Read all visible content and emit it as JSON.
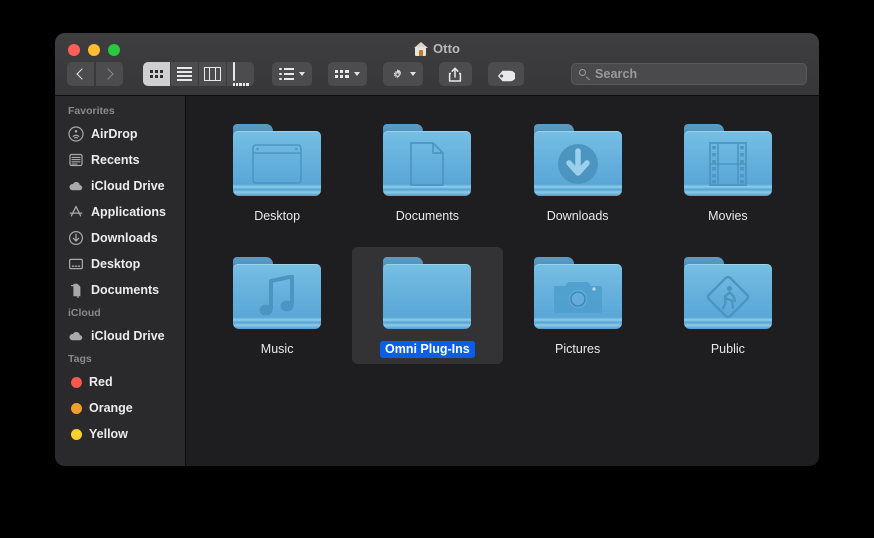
{
  "window": {
    "title": "Otto",
    "title_icon": "home-icon"
  },
  "traffic_lights": [
    {
      "name": "close-button",
      "color": "#ff5f57"
    },
    {
      "name": "minimize-button",
      "color": "#febc2e"
    },
    {
      "name": "maximize-button",
      "color": "#28c840"
    }
  ],
  "toolbar": {
    "back_icon": "chevron-left-icon",
    "forward_icon": "chevron-right-icon",
    "view_modes": [
      {
        "label": "Icon view",
        "icon": "grid-icon",
        "active": true
      },
      {
        "label": "List view",
        "icon": "list-icon",
        "active": false
      },
      {
        "label": "Column view",
        "icon": "columns-icon",
        "active": false
      },
      {
        "label": "Gallery view",
        "icon": "gallery-icon",
        "active": false
      }
    ],
    "arrange_icon": "arrange-icon",
    "group_icon": "group-icon",
    "action_icon": "gear-icon",
    "share_icon": "share-icon",
    "tag_icon": "tag-icon"
  },
  "search": {
    "placeholder": "Search",
    "value": "",
    "icon": "search-icon"
  },
  "sidebar": {
    "sections": [
      {
        "header": "Favorites",
        "items": [
          {
            "label": "AirDrop",
            "icon": "airdrop-icon"
          },
          {
            "label": "Recents",
            "icon": "recents-icon"
          },
          {
            "label": "iCloud Drive",
            "icon": "cloud-icon"
          },
          {
            "label": "Applications",
            "icon": "applications-icon"
          },
          {
            "label": "Downloads",
            "icon": "downloads-icon"
          },
          {
            "label": "Desktop",
            "icon": "desktop-icon"
          },
          {
            "label": "Documents",
            "icon": "documents-icon"
          }
        ]
      },
      {
        "header": "iCloud",
        "items": [
          {
            "label": "iCloud Drive",
            "icon": "cloud-icon"
          }
        ]
      },
      {
        "header": "Tags",
        "items": [
          {
            "label": "Red",
            "icon": "tag-dot",
            "color": "#f7584c"
          },
          {
            "label": "Orange",
            "icon": "tag-dot",
            "color": "#f0a02a"
          },
          {
            "label": "Yellow",
            "icon": "tag-dot",
            "color": "#f7d02c"
          }
        ]
      }
    ]
  },
  "content": {
    "items": [
      {
        "label": "Desktop",
        "glyph": "window-glyph",
        "selected": false
      },
      {
        "label": "Documents",
        "glyph": "document-glyph",
        "selected": false
      },
      {
        "label": "Downloads",
        "glyph": "download-glyph",
        "selected": false
      },
      {
        "label": "Movies",
        "glyph": "film-glyph",
        "selected": false
      },
      {
        "label": "Music",
        "glyph": "music-glyph",
        "selected": false
      },
      {
        "label": "Omni Plug-Ins",
        "glyph": "none",
        "selected": true
      },
      {
        "label": "Pictures",
        "glyph": "camera-glyph",
        "selected": false
      },
      {
        "label": "Public",
        "glyph": "pedestrian-glyph",
        "selected": false
      }
    ]
  },
  "colors": {
    "selection_blue": "#0a5fe8",
    "folder_blue": "#63aedb",
    "toolbar_bg": "#3a3a3c",
    "sidebar_bg": "#2a2a2c",
    "content_bg": "#1e1e20"
  }
}
